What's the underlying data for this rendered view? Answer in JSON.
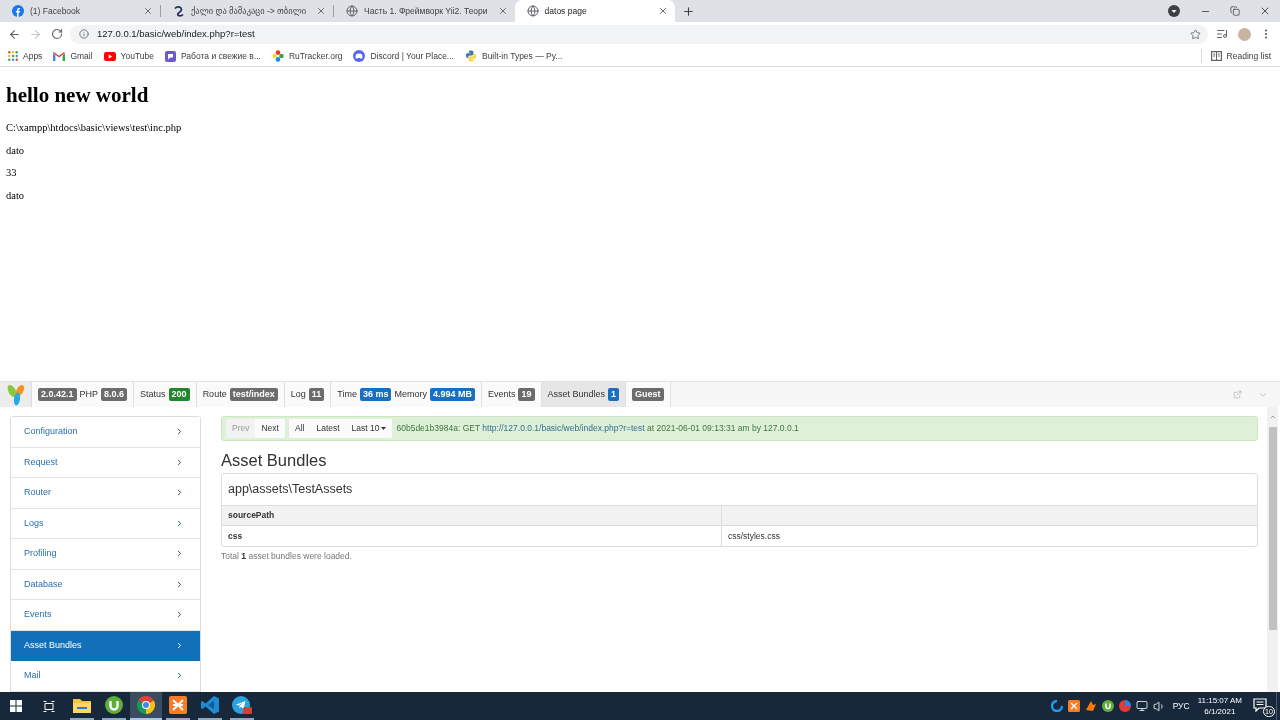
{
  "browser": {
    "tabs": [
      {
        "title": "(1) Facebook",
        "kind": "facebook",
        "selected": false
      },
      {
        "title": "ქალი და მამაკაცი -> თბილი",
        "kind": "site",
        "selected": false
      },
      {
        "title": "Часть 1. Фреймворк Yii2. Теори",
        "kind": "globe",
        "selected": false
      },
      {
        "title": "datos page",
        "kind": "globe",
        "selected": true
      }
    ],
    "address": "127.0.0.1/basic/web/index.php?r=test",
    "bookmarks": [
      {
        "label": "Apps",
        "kind": "apps"
      },
      {
        "label": "Gmail",
        "kind": "mail"
      },
      {
        "label": "YouTube",
        "kind": "video"
      },
      {
        "label": "Работа и свежие в...",
        "kind": "jobs"
      },
      {
        "label": "RuTracker.org",
        "kind": "tracker"
      },
      {
        "label": "Discord | Your Place...",
        "kind": "chat"
      },
      {
        "label": "Built-in Types — Py...",
        "kind": "python"
      }
    ],
    "reading_list": "Reading list"
  },
  "page": {
    "heading": "hello new world",
    "lines": [
      "C:\\xampp\\htdocs\\basic\\views\\test\\inc.php",
      "dato",
      "33",
      "dato"
    ]
  },
  "debug_toolbar": {
    "blocks": [
      {
        "selected": false,
        "parts": [
          {
            "kind": "badge",
            "text": "2.0.42.1",
            "color": "#6c6c6c"
          },
          {
            "kind": "label",
            "text": "PHP"
          },
          {
            "kind": "badge",
            "text": "8.0.6",
            "color": "#6c6c6c"
          }
        ]
      },
      {
        "selected": false,
        "parts": [
          {
            "kind": "label",
            "text": "Status"
          },
          {
            "kind": "badge",
            "text": "200",
            "color": "#23862c"
          }
        ]
      },
      {
        "selected": false,
        "parts": [
          {
            "kind": "label",
            "text": "Route"
          },
          {
            "kind": "badge",
            "text": "test/index",
            "color": "#6c6c6c"
          }
        ]
      },
      {
        "selected": false,
        "parts": [
          {
            "kind": "label",
            "text": "Log"
          },
          {
            "kind": "badge",
            "text": "11",
            "color": "#6c6c6c"
          }
        ]
      },
      {
        "selected": false,
        "parts": [
          {
            "kind": "label",
            "text": "Time"
          },
          {
            "kind": "badge",
            "text": "36 ms",
            "color": "#1a6fc0"
          },
          {
            "kind": "label",
            "text": "Memory"
          },
          {
            "kind": "badge",
            "text": "4.994 MB",
            "color": "#1a6fc0"
          }
        ]
      },
      {
        "selected": false,
        "parts": [
          {
            "kind": "label",
            "text": "Events"
          },
          {
            "kind": "badge",
            "text": "19",
            "color": "#6c6c6c"
          }
        ]
      },
      {
        "selected": true,
        "parts": [
          {
            "kind": "label",
            "text": "Asset Bundles"
          },
          {
            "kind": "badge",
            "text": "1",
            "color": "#1a6fc0"
          }
        ]
      },
      {
        "selected": false,
        "parts": [
          {
            "kind": "badge",
            "text": "Guest",
            "color": "#6c6c6c"
          }
        ]
      }
    ]
  },
  "debug_panel": {
    "nav": [
      {
        "label": "Configuration",
        "selected": false
      },
      {
        "label": "Request",
        "selected": false
      },
      {
        "label": "Router",
        "selected": false
      },
      {
        "label": "Logs",
        "selected": false
      },
      {
        "label": "Profiling",
        "selected": false
      },
      {
        "label": "Database",
        "selected": false
      },
      {
        "label": "Events",
        "selected": false
      },
      {
        "label": "Asset Bundles",
        "selected": true
      },
      {
        "label": "Mail",
        "selected": false
      }
    ],
    "summary": {
      "pager": [
        {
          "label": "Prev",
          "disabled": true
        },
        {
          "label": "Next",
          "disabled": false
        }
      ],
      "filters": [
        {
          "label": "All",
          "kind": "button"
        },
        {
          "label": "Latest",
          "kind": "button"
        },
        {
          "label": "Last 10",
          "kind": "dropdown"
        }
      ],
      "prefix": "60b5de1b3984a: GET",
      "link": "http://127.0.0.1/basic/web/index.php?r=test",
      "suffix": "at 2021-06-01 09:13:31 am by 127.0.0.1"
    },
    "title": "Asset Bundles",
    "bundles": [
      {
        "name": "app\\assets\\TestAssets",
        "rows": [
          {
            "kind": "heading",
            "key": "sourcePath"
          },
          {
            "kind": "value",
            "key": "css",
            "value": "css/styles.css"
          }
        ]
      }
    ],
    "footer": "Total **1** asset bundles were loaded."
  },
  "taskbar": {
    "apps": [
      {
        "kind": "explorer",
        "selected": false,
        "running": true
      },
      {
        "kind": "torrent",
        "selected": false,
        "running": true
      },
      {
        "kind": "browser",
        "selected": true,
        "running": true
      },
      {
        "kind": "xampp",
        "selected": false,
        "running": true
      },
      {
        "kind": "editor",
        "selected": false,
        "running": true
      },
      {
        "kind": "messenger",
        "selected": false,
        "running": true
      }
    ],
    "language": "РУС",
    "time": "11:15:07 AM",
    "date": "6/1/2021",
    "notifications": "10"
  }
}
